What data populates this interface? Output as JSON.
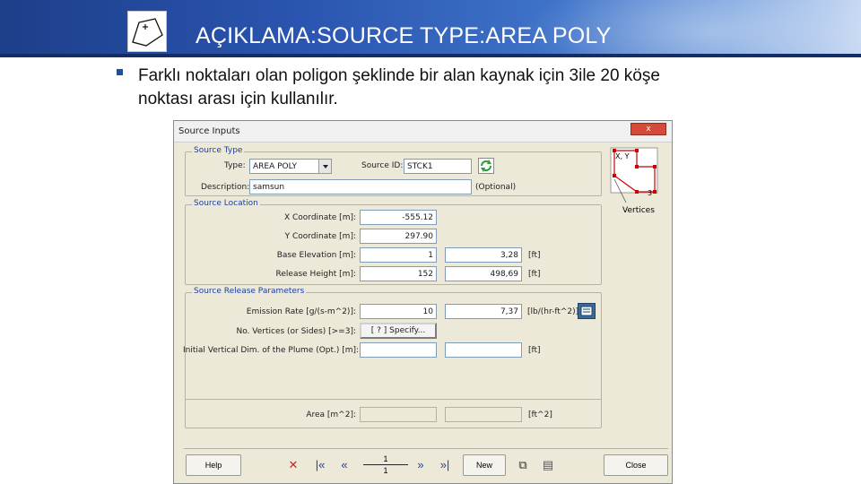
{
  "slide": {
    "title": "AÇIKLAMA:SOURCE TYPE:AREA POLY",
    "bullet_line1": "Farklı noktaları olan poligon şeklinde bir alan kaynak için 3ile 20 köşe",
    "bullet_line2": "noktası arası için kullanılır."
  },
  "dialog": {
    "title": "Source Inputs",
    "close": "x",
    "source_type": {
      "group_label": "Source Type",
      "type_label": "Type:",
      "type_value": "AREA POLY",
      "id_label": "Source ID:",
      "id_value": "STCK1",
      "desc_label": "Description:",
      "desc_value": "samsun",
      "optional": "(Optional)"
    },
    "diagram": {
      "xy": "X, Y",
      "count": "3",
      "vertices": "Vertices"
    },
    "location": {
      "group_label": "Source Location",
      "x_label": "X Coordinate [m]:",
      "x_value": "-555.12",
      "y_label": "Y Coordinate [m]:",
      "y_value": "297.90",
      "elev_label": "Base Elevation [m]:",
      "elev_value": "1",
      "elev_ft": "3,28",
      "elev_unit": "[ft]",
      "height_label": "Release Height [m]:",
      "height_value": "152",
      "height_ft": "498,69",
      "height_unit": "[ft]"
    },
    "release": {
      "group_label": "Source Release Parameters",
      "rate_label": "Emission Rate [g/(s-m^2)]:",
      "rate_value": "10",
      "rate_alt": "7,37",
      "rate_unit": "[lb/(hr-ft^2)]",
      "vert_label": "No. Vertices (or Sides) [>=3]:",
      "specify_label": "[ ? ]    Specify...",
      "dim_label": "Initial Vertical Dim. of the Plume (Opt.) [m]:",
      "dim_unit": "[ft]",
      "area_label": "Area [m^2]:",
      "area_unit": "[ft^2]"
    },
    "toolbar": {
      "help": "Help",
      "delete_icon": "✕",
      "first_icon": "|«",
      "prev_icon": "«",
      "record_current": "1",
      "record_total": "1",
      "next_icon": "»",
      "last_icon": "»|",
      "new": "New",
      "copy_icon": "⧉",
      "paste_icon": "▤",
      "close": "Close"
    }
  },
  "colors": {
    "header_dark": "#1d3f8a",
    "group_label": "#1c3f9e",
    "dialog_bg": "#ece9d8",
    "diagram_red": "#cc0000"
  }
}
